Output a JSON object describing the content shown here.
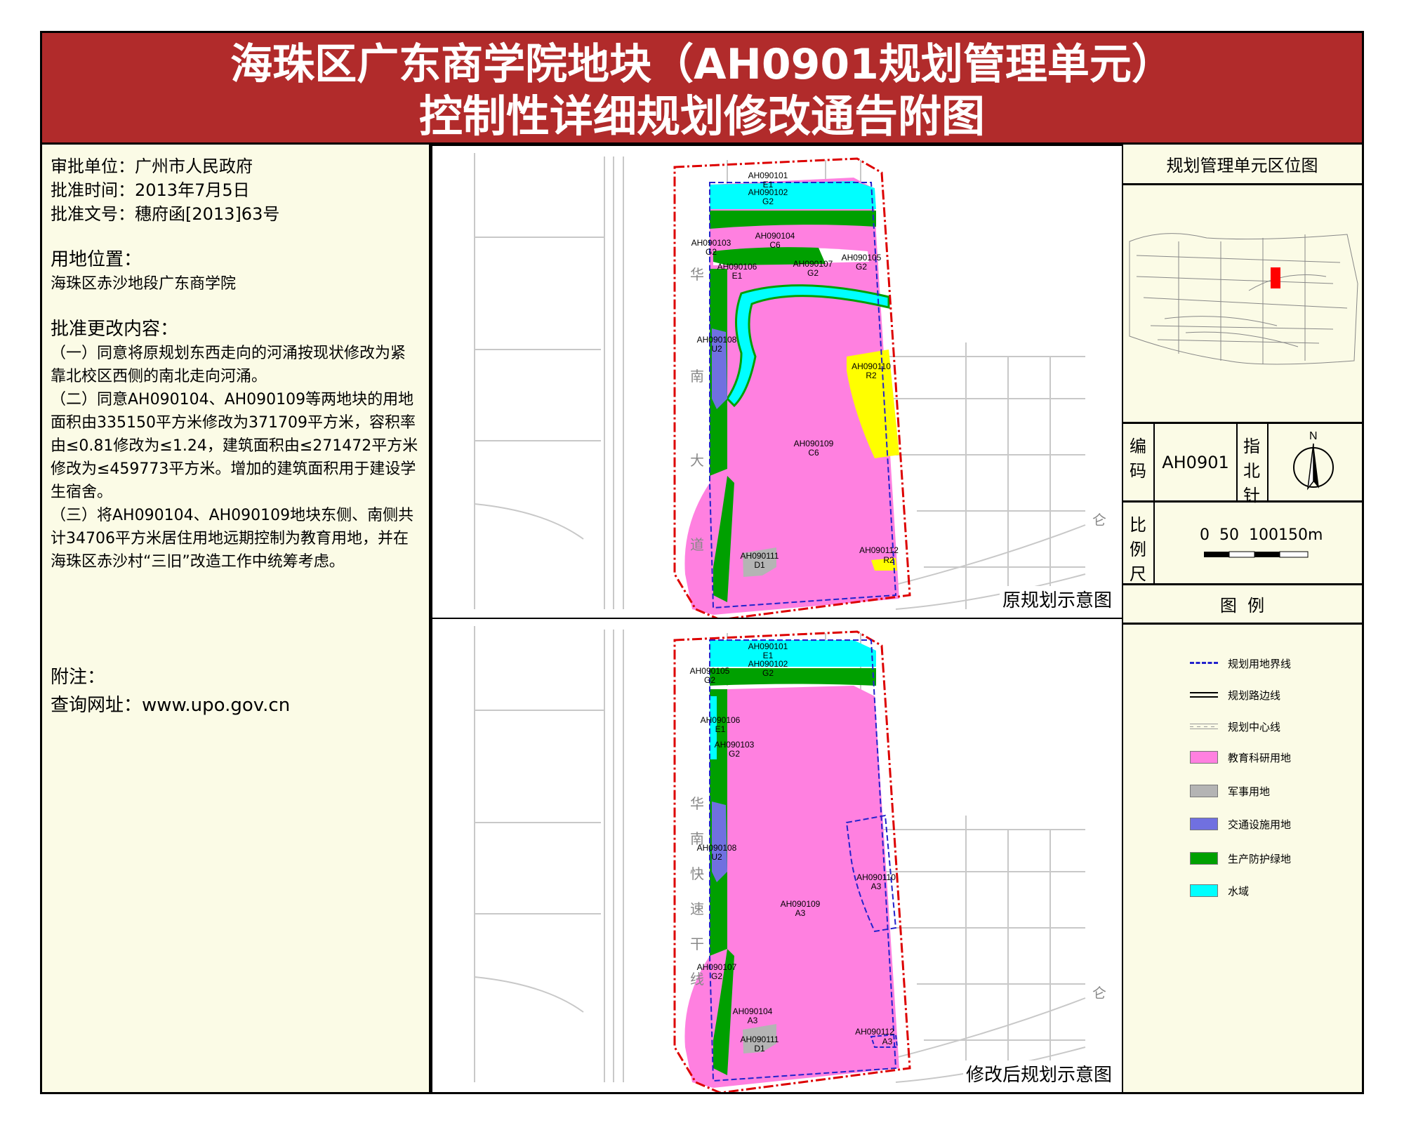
{
  "title": {
    "line1": "海珠区广东商学院地块（AH0901规划管理单元）",
    "line2": "控制性详细规划修改通告附图"
  },
  "info": {
    "approval_unit": "审批单位：广州市人民政府",
    "approval_time": "批准时间：2013年7月5日",
    "approval_doc": "批准文号：穗府函[2013]63号",
    "location_head": "用地位置：",
    "location": "海珠区赤沙地段广东商学院",
    "changes_head": "批准更改内容：",
    "change1": "（一）同意将原规划东西走向的河涌按现状修改为紧靠北校区西侧的南北走向河涌。",
    "change2": "（二）同意AH090104、AH090109等两地块的用地面积由335150平方米修改为371709平方米，容积率由≤0.81修改为≤1.24，建筑面积由≤271472平方米修改为≤459773平方米。增加的建筑面积用于建设学生宿舍。",
    "change3": "（三）将AH090104、AH090109地块东侧、南侧共计34706平方米居住用地远期控制为教育用地，并在海珠区赤沙村“三旧”改造工作中统筹考虑。",
    "note_head": "附注：",
    "query": "查询网址：www.upo.gov.cn"
  },
  "maps": {
    "original_caption": "原规划示意图",
    "modified_caption": "修改后规划示意图",
    "road_chars_top": [
      "华",
      "南",
      "大",
      "道"
    ],
    "road_chars_bottom": [
      "华",
      "南",
      "快",
      "速",
      "干",
      "线"
    ],
    "road_char_cang": "仑",
    "original_parcels": [
      {
        "code": "AH090101",
        "use": "E1"
      },
      {
        "code": "AH090102",
        "use": "G2"
      },
      {
        "code": "AH090103",
        "use": "G2"
      },
      {
        "code": "AH090104",
        "use": "C6"
      },
      {
        "code": "AH090105",
        "use": "G2"
      },
      {
        "code": "AH090106",
        "use": "E1"
      },
      {
        "code": "AH090107",
        "use": "G2"
      },
      {
        "code": "AH090108",
        "use": "U2"
      },
      {
        "code": "AH090109",
        "use": "C6"
      },
      {
        "code": "AH090110",
        "use": "R2"
      },
      {
        "code": "AH090111",
        "use": "D1"
      },
      {
        "code": "AH090112",
        "use": "R2"
      }
    ],
    "modified_parcels": [
      {
        "code": "AH090101",
        "use": "E1"
      },
      {
        "code": "AH090102",
        "use": "G2"
      },
      {
        "code": "AH090105",
        "use": "G2"
      },
      {
        "code": "AH090106",
        "use": "E1"
      },
      {
        "code": "AH090103",
        "use": "G2"
      },
      {
        "code": "AH090108",
        "use": "U2"
      },
      {
        "code": "AH090110",
        "use": "A3"
      },
      {
        "code": "AH090109",
        "use": "A3"
      },
      {
        "code": "AH090107",
        "use": "G2"
      },
      {
        "code": "AH090104",
        "use": "A3"
      },
      {
        "code": "AH090111",
        "use": "D1"
      },
      {
        "code": "AH090112",
        "use": "A3"
      }
    ]
  },
  "right": {
    "location_title": "规划管理单元区位图",
    "code_label": "编码",
    "code_value": "AH0901",
    "north_label": "指北针",
    "north_letter": "N",
    "scale_label": "比例尺",
    "scale_text": "0  50  100150m",
    "legend_title": "图  例"
  },
  "legend": [
    {
      "label": "规划用地界线",
      "type": "dash",
      "color": "#2222cc"
    },
    {
      "label": "规划路边线",
      "type": "double",
      "color": "#000000"
    },
    {
      "label": "规划中心线",
      "type": "center",
      "color": "#888888"
    },
    {
      "label": "教育科研用地",
      "type": "fill",
      "color": "#ff80e0"
    },
    {
      "label": "军事用地",
      "type": "fill",
      "color": "#b4b4b4"
    },
    {
      "label": "交通设施用地",
      "type": "fill",
      "color": "#7070e0"
    },
    {
      "label": "生产防护绿地",
      "type": "fill",
      "color": "#00a000"
    },
    {
      "label": "水域",
      "type": "fill",
      "color": "#00ffff"
    }
  ],
  "colors": {
    "title_bg": "#b12b2b",
    "panel_bg": "#fbfbe6",
    "edu": "#ff80e0",
    "green": "#00a000",
    "water": "#00ffff",
    "res": "#ffff00",
    "mil": "#b4b4b4",
    "traffic": "#7070e0",
    "boundary": "#dd0000"
  }
}
